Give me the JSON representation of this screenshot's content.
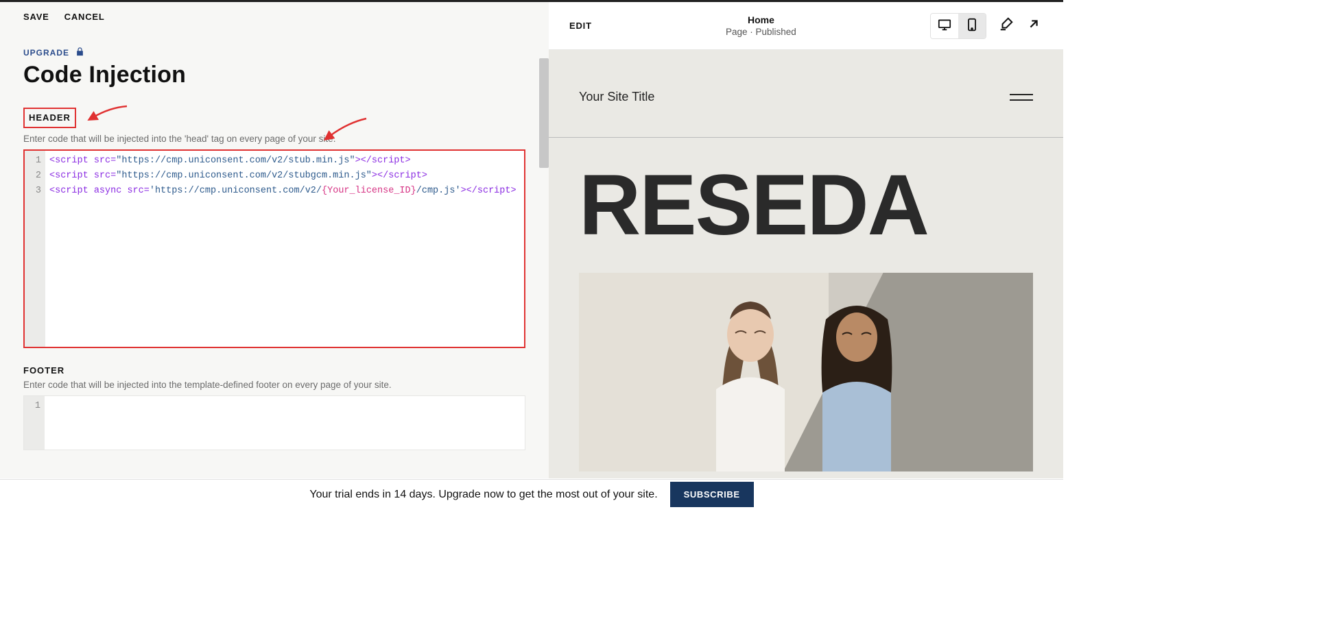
{
  "left": {
    "save": "SAVE",
    "cancel": "CANCEL",
    "upgrade": "UPGRADE",
    "title": "Code Injection",
    "header_label": "HEADER",
    "header_desc": "Enter code that will be injected into the 'head' tag on every page of your site.",
    "footer_label": "FOOTER",
    "footer_desc": "Enter code that will be injected into the template-defined footer on every page of your site.",
    "code": {
      "lines": [
        {
          "n": "1",
          "src": "https://cmp.uniconsent.com/v2/stub.min.js",
          "async": false,
          "quote": "\""
        },
        {
          "n": "2",
          "src": "https://cmp.uniconsent.com/v2/stubgcm.min.js",
          "async": false,
          "quote": "\""
        },
        {
          "n": "3",
          "src_prefix": "https://cmp.uniconsent.com/v2/",
          "src_placeholder": "{Your_license_ID}",
          "src_suffix": "/cmp.js",
          "async": true,
          "quote": "'"
        }
      ]
    },
    "footer_code": {
      "lines": [
        {
          "n": "1"
        }
      ]
    }
  },
  "preview": {
    "edit": "EDIT",
    "page_name": "Home",
    "page_meta": "Page · Published",
    "site_title": "Your Site Title",
    "hero": "RESEDA"
  },
  "trial": {
    "text": "Your trial ends in 14 days. Upgrade now to get the most out of your site.",
    "button": "SUBSCRIBE"
  }
}
